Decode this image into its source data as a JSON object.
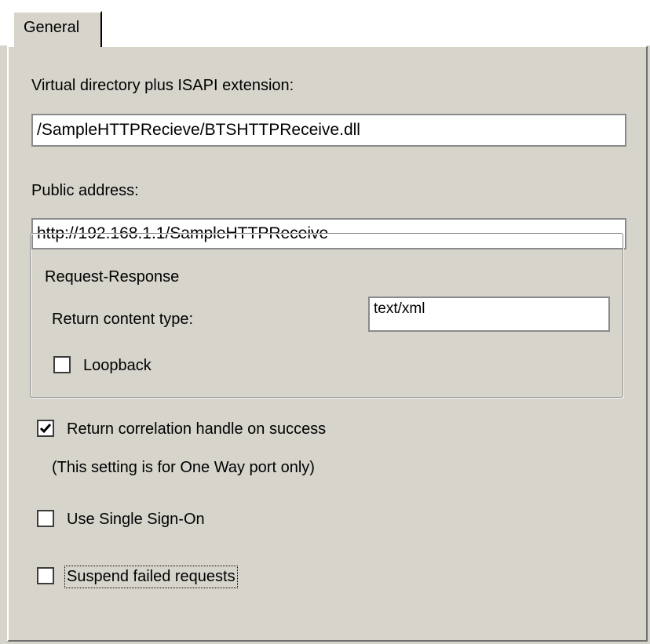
{
  "tabs": [
    {
      "label": "General"
    }
  ],
  "virtual_directory": {
    "label": "Virtual directory plus ISAPI extension:",
    "value": "/SampleHTTPRecieve/BTSHTTPReceive.dll"
  },
  "public_address": {
    "label": "Public address:",
    "value": "http://192.168.1.1/SampleHTTPReceive"
  },
  "request_response": {
    "caption": "Request-Response",
    "return_content_type_label": "Return content type:",
    "return_content_type_value": "text/xml",
    "loopback_label": "Loopback",
    "loopback_checked": false
  },
  "return_correlation": {
    "label": "Return correlation handle on success",
    "checked": true,
    "note": "(This setting is for One Way port only)"
  },
  "single_sign_on": {
    "label": "Use Single Sign-On",
    "checked": false
  },
  "suspend_failed": {
    "label": "Suspend failed requests",
    "checked": false
  }
}
